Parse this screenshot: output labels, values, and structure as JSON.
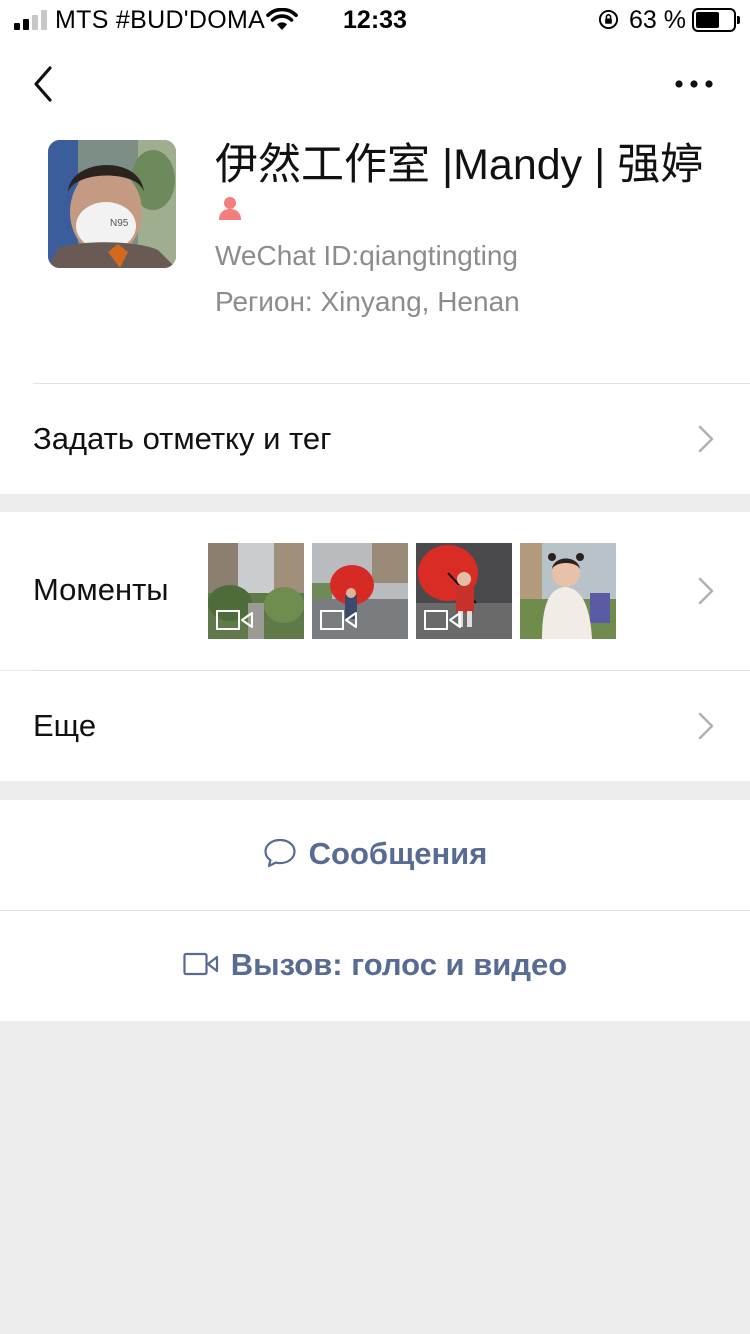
{
  "status_bar": {
    "carrier": "MTS #BUD'DOMA",
    "time": "12:33",
    "battery_percent": "63 %"
  },
  "profile": {
    "name": "伊然工作室 |Mandy | 强婷",
    "gender": "female",
    "wechat_id": "WeChat ID:qiangtingting",
    "region": "Регион:  Xinyang, Henan"
  },
  "rows": {
    "tag_label": "Задать отметку и тег",
    "moments_label": "Моменты",
    "more_label": "Еще"
  },
  "moments_thumbs": [
    {
      "type": "video",
      "scene": "street-trees"
    },
    {
      "type": "video",
      "scene": "red-umbrella-child"
    },
    {
      "type": "video",
      "scene": "red-umbrella-child-close"
    },
    {
      "type": "photo",
      "scene": "child-playground"
    }
  ],
  "actions": {
    "message_label": "Сообщения",
    "call_label": "Вызов: голос и видео"
  },
  "colors": {
    "link": "#576b95",
    "gender_female": "#f37e7d",
    "secondary_text": "#8c8c8c",
    "background": "#ededed"
  },
  "icons": {
    "back": "chevron-left-icon",
    "more": "more-dots-icon",
    "gender": "female-icon",
    "chevron": "chevron-right-icon",
    "message": "chat-bubble-icon",
    "call": "video-camera-icon"
  }
}
